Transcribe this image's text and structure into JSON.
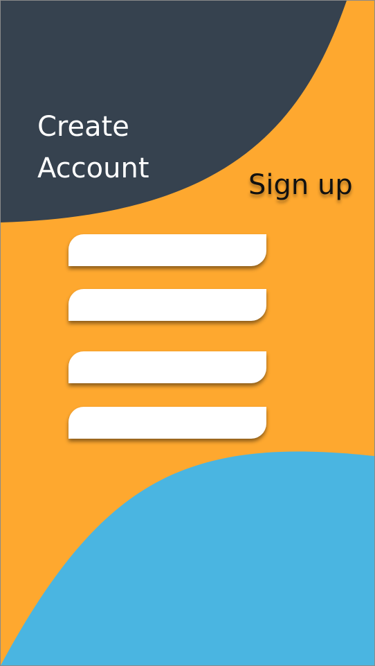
{
  "screen": {
    "title_line1": "Create",
    "title_line2": "Account",
    "signup_label": "Sign up"
  },
  "fields": [
    {
      "value": "",
      "placeholder": ""
    },
    {
      "value": "",
      "placeholder": ""
    },
    {
      "value": "",
      "placeholder": ""
    },
    {
      "value": "",
      "placeholder": ""
    }
  ],
  "colors": {
    "background": "#FEA82F",
    "header_blob": "#36424F",
    "footer_blob": "#4AB5E1",
    "field": "#FFFFFF",
    "title_text": "#FFFFFF",
    "signup_text": "#111111"
  }
}
